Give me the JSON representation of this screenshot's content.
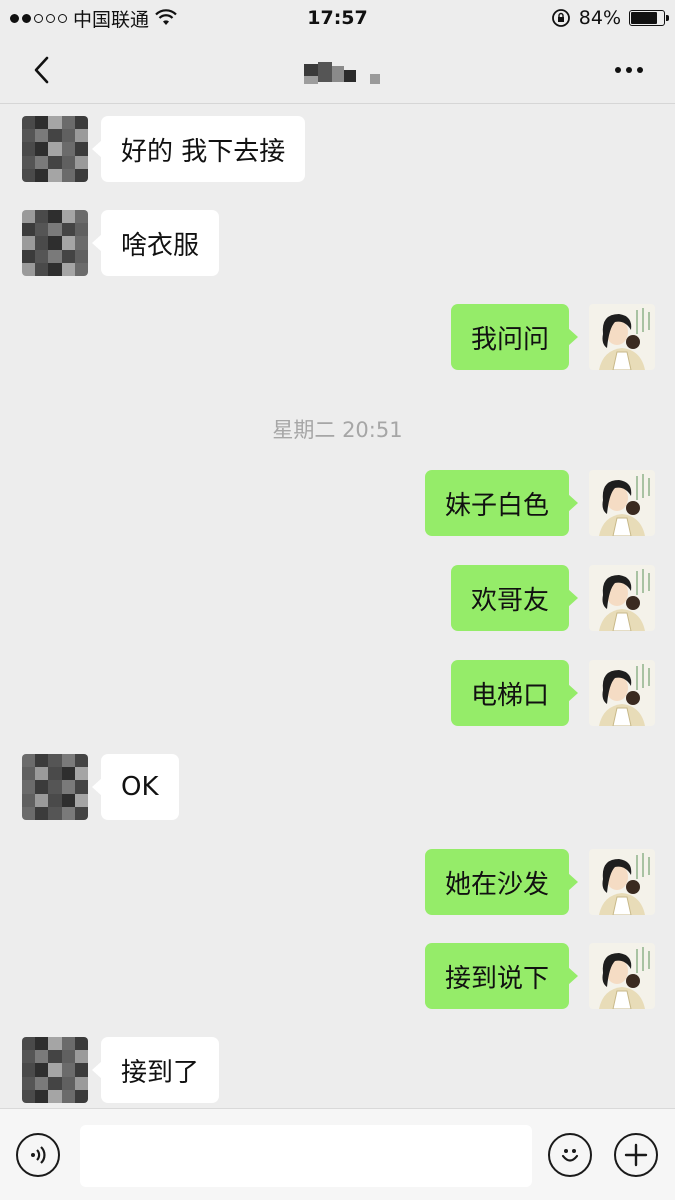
{
  "status_bar": {
    "carrier": "中国联通",
    "time": "17:57",
    "battery_text": "84%",
    "battery_level": 0.84,
    "signal_dots": [
      true,
      true,
      false,
      false,
      false
    ]
  },
  "nav": {
    "back_icon": "chevron-left-icon",
    "more_icon": "more-dots-icon"
  },
  "chat": {
    "messages": [
      {
        "side": "in",
        "text": "好的 我下去接"
      },
      {
        "side": "in",
        "text": "啥衣服"
      },
      {
        "side": "out",
        "text": "我问问"
      },
      {
        "side": "time",
        "text": "星期二 20:51"
      },
      {
        "side": "out",
        "text": "妹子白色"
      },
      {
        "side": "out",
        "text": "欢哥友"
      },
      {
        "side": "out",
        "text": "电梯口"
      },
      {
        "side": "in",
        "text": "OK"
      },
      {
        "side": "out",
        "text": "她在沙发"
      },
      {
        "side": "out",
        "text": "接到说下"
      },
      {
        "side": "in",
        "text": "接到了"
      }
    ]
  },
  "input_bar": {
    "voice_icon": "voice-icon",
    "emoji_icon": "emoji-icon",
    "plus_icon": "plus-icon",
    "input_value": ""
  },
  "colors": {
    "background": "#ededed",
    "bubble_out": "#95ec69",
    "bubble_in": "#ffffff"
  }
}
